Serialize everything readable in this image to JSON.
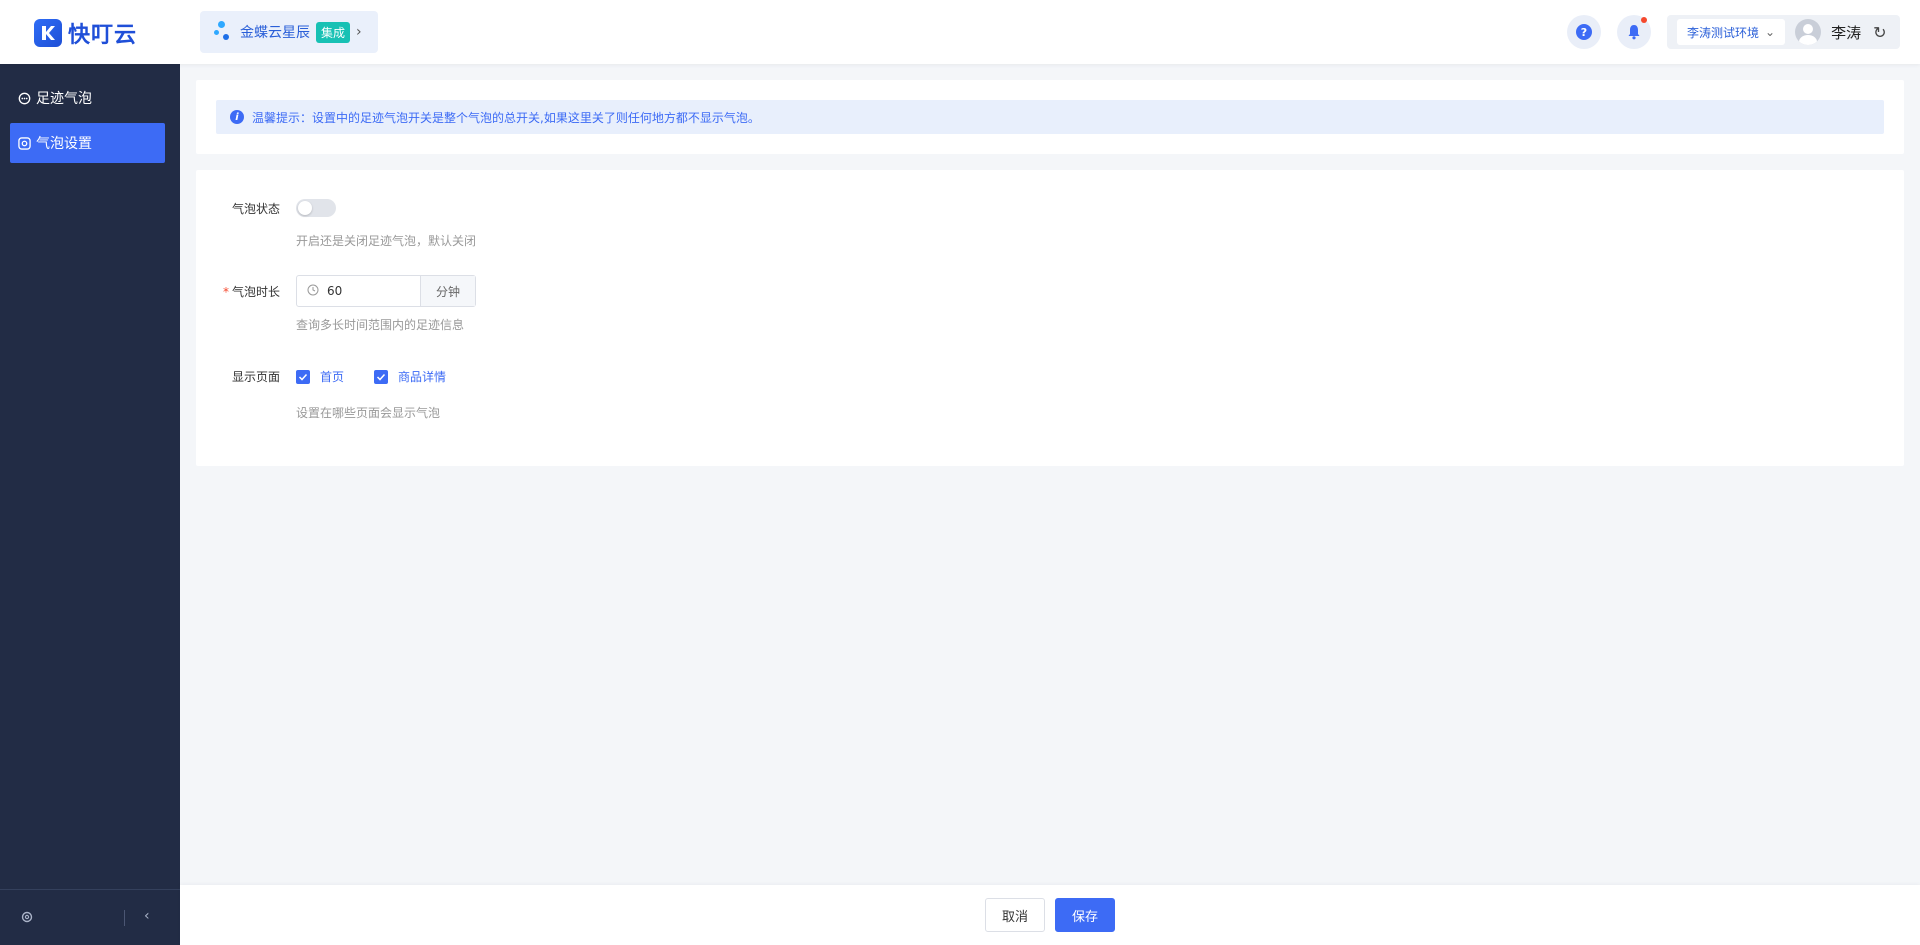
{
  "header": {
    "logo_text": "快叮云",
    "app_name": "金蝶云星辰",
    "app_badge": "集成",
    "env_select": "李涛测试环境",
    "username": "李涛"
  },
  "sidebar": {
    "items": [
      {
        "label": "足迹气泡",
        "icon": "message-icon",
        "active": false
      },
      {
        "label": "气泡设置",
        "icon": "settings-icon",
        "active": true
      }
    ]
  },
  "tip": {
    "text": "温馨提示：设置中的足迹气泡开关是整个气泡的总开关,如果这里关了则任何地方都不显示气泡。"
  },
  "form": {
    "status": {
      "label": "气泡状态",
      "enabled": false,
      "help": "开启还是关闭足迹气泡，默认关闭"
    },
    "duration": {
      "label": "气泡时长",
      "required": true,
      "value": "60",
      "unit": "分钟",
      "help": "查询多长时间范围内的足迹信息"
    },
    "pages": {
      "label": "显示页面",
      "options": [
        {
          "label": "首页",
          "checked": true
        },
        {
          "label": "商品详情",
          "checked": true
        }
      ],
      "help": "设置在哪些页面会显示气泡"
    }
  },
  "footer": {
    "cancel_label": "取消",
    "save_label": "保存"
  },
  "colors": {
    "primary": "#3d6bf5",
    "sidebar_bg": "#222c45",
    "tip_bg": "#e8effc",
    "badge": "#18c1b4"
  }
}
